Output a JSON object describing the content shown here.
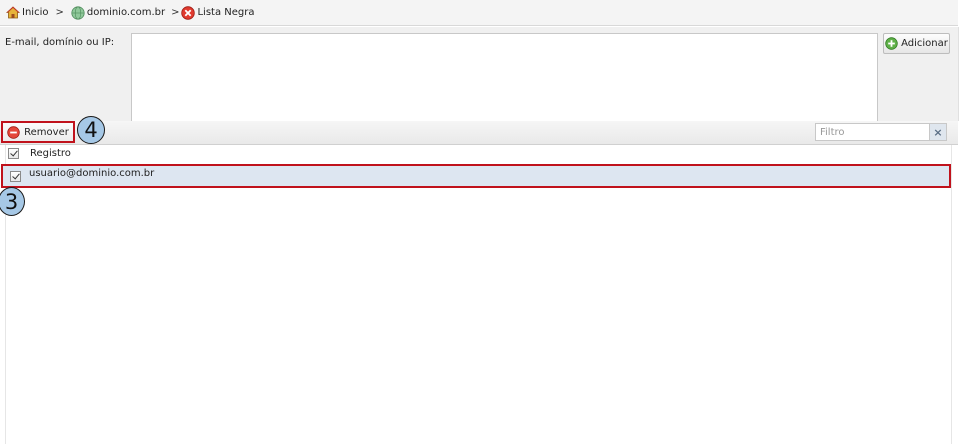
{
  "breadcrumb": {
    "items": [
      {
        "label": "Inicio",
        "icon": "home-icon"
      },
      {
        "label": "dominio.com.br",
        "icon": "globe-icon"
      },
      {
        "label": "Lista Negra",
        "icon": "blocked-icon"
      }
    ],
    "separator": ">"
  },
  "form": {
    "label": "E-mail, domínio ou IP:",
    "textarea_value": "",
    "add_label": "Adicionar"
  },
  "toolbar": {
    "remove_label": "Remover",
    "filter_placeholder": "Filtro",
    "clear_symbol": "×"
  },
  "list": {
    "header_label": "Registro",
    "header_checked": true,
    "rows": [
      {
        "value": "usuario@dominio.com.br",
        "checked": true,
        "selected": true
      }
    ]
  },
  "callouts": {
    "remove_marker": "4",
    "row_marker": "3"
  },
  "colors": {
    "highlight_border": "#c0121c",
    "callout_fill": "#a6c8e6",
    "selected_row": "#dde6f1"
  }
}
